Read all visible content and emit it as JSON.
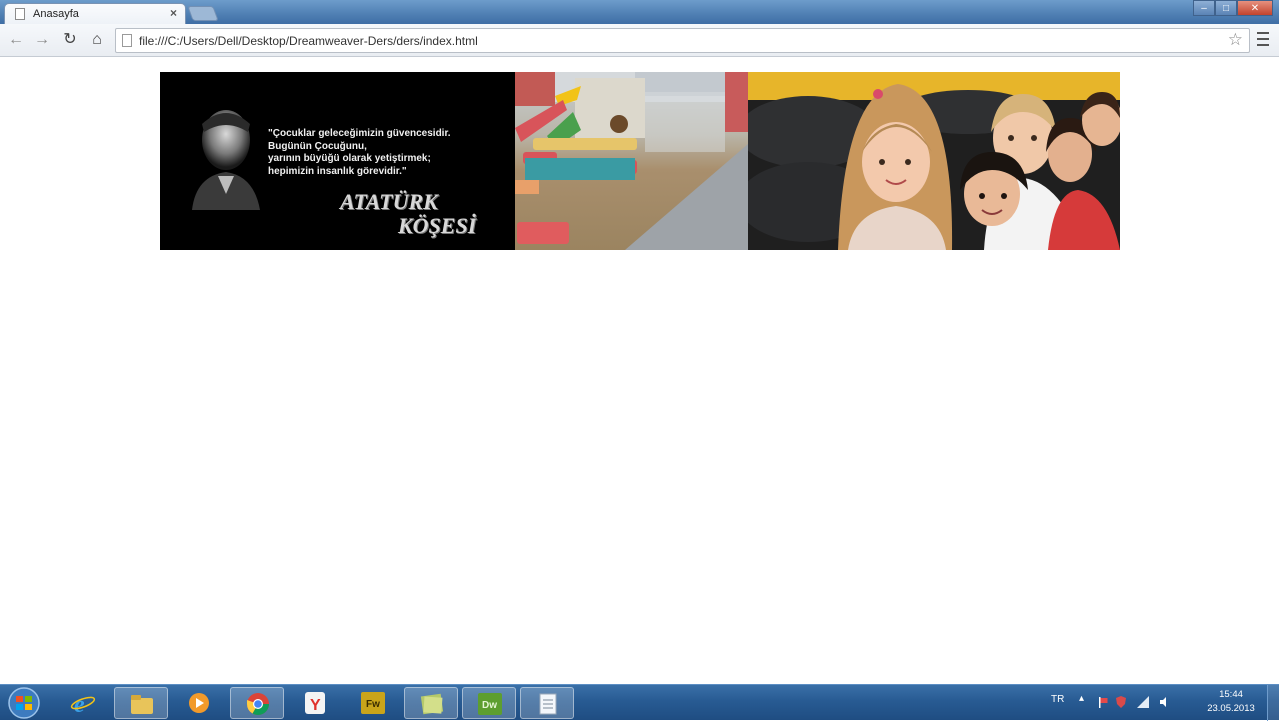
{
  "browser": {
    "tab_title": "Anasayfa",
    "tab_close": "×",
    "url": "file:///C:/Users/Dell/Desktop/Dreamweaver-Ders/ders/index.html"
  },
  "banner": {
    "quote_lines": [
      "\"Çocuklar geleceğimizin güvencesidir.",
      "Bugünün Çocuğunu,",
      "yarının büyüğü olarak yetiştirmek;",
      "hepimizin insanlık görevidir.\""
    ],
    "corner_title_line1": "ATATÜRK",
    "corner_title_line2": "KÖŞESİ"
  },
  "taskbar": {
    "apps": [
      "start",
      "internet-explorer",
      "windows-explorer",
      "media-player",
      "chrome",
      "yandex",
      "fireworks",
      "sticky",
      "dreamweaver",
      "notepad"
    ],
    "language": "TR",
    "time": "15:44",
    "date": "23.05.2013"
  }
}
